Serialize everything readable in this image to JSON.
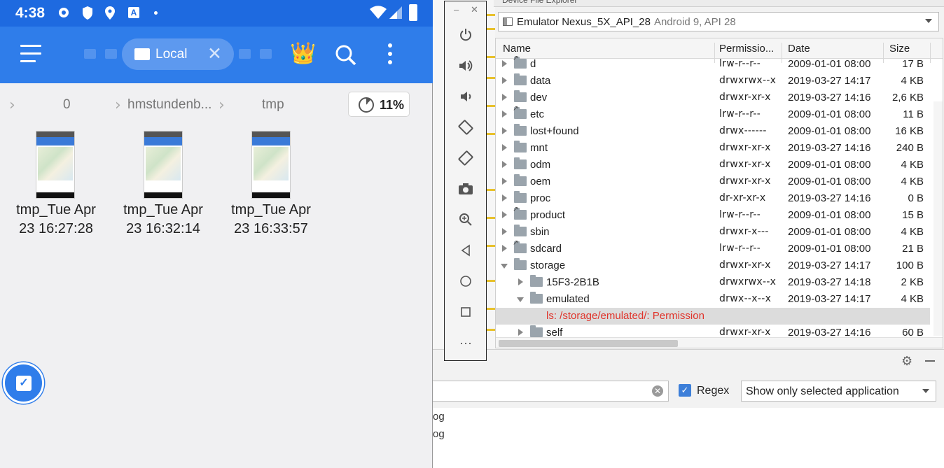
{
  "phone": {
    "status_time": "4:38",
    "appbar": {
      "local_tab_label": "Local"
    },
    "breadcrumbs": [
      "0",
      "hmstundenb...",
      "tmp"
    ],
    "storage_percent": "11%",
    "files": [
      {
        "line1": "tmp_Tue Apr",
        "line2": "23 16:27:28"
      },
      {
        "line1": "tmp_Tue Apr",
        "line2": "23 16:32:14"
      },
      {
        "line1": "tmp_Tue Apr",
        "line2": "23 16:33:57"
      }
    ]
  },
  "device_explorer": {
    "device_name": "Emulator Nexus_5X_API_28",
    "device_detail": "Android 9, API 28",
    "columns": {
      "name": "Name",
      "permissions": "Permissio...",
      "date": "Date",
      "size": "Size"
    },
    "rows": [
      {
        "name": "d",
        "perm": "lrw-r--r--",
        "date": "2009-01-01 08:00",
        "size": "17 B",
        "link": true
      },
      {
        "name": "data",
        "perm": "drwxrwx--x",
        "date": "2019-03-27 14:17",
        "size": "4 KB"
      },
      {
        "name": "dev",
        "perm": "drwxr-xr-x",
        "date": "2019-03-27 14:16",
        "size": "2,6 KB"
      },
      {
        "name": "etc",
        "perm": "lrw-r--r--",
        "date": "2009-01-01 08:00",
        "size": "11 B",
        "link": true
      },
      {
        "name": "lost+found",
        "perm": "drwx------",
        "date": "2009-01-01 08:00",
        "size": "16 KB"
      },
      {
        "name": "mnt",
        "perm": "drwxr-xr-x",
        "date": "2019-03-27 14:16",
        "size": "240 B"
      },
      {
        "name": "odm",
        "perm": "drwxr-xr-x",
        "date": "2009-01-01 08:00",
        "size": "4 KB"
      },
      {
        "name": "oem",
        "perm": "drwxr-xr-x",
        "date": "2009-01-01 08:00",
        "size": "4 KB"
      },
      {
        "name": "proc",
        "perm": "dr-xr-xr-x",
        "date": "2019-03-27 14:16",
        "size": "0 B"
      },
      {
        "name": "product",
        "perm": "lrw-r--r--",
        "date": "2009-01-01 08:00",
        "size": "15 B",
        "link": true
      },
      {
        "name": "sbin",
        "perm": "drwxr-x---",
        "date": "2009-01-01 08:00",
        "size": "4 KB"
      },
      {
        "name": "sdcard",
        "perm": "lrw-r--r--",
        "date": "2009-01-01 08:00",
        "size": "21 B",
        "link": true
      },
      {
        "name": "storage",
        "perm": "drwxr-xr-x",
        "date": "2019-03-27 14:17",
        "size": "100 B",
        "expanded": true
      },
      {
        "name": "15F3-2B1B",
        "perm": "drwxrwx--x",
        "date": "2019-03-27 14:18",
        "size": "2 KB",
        "indent": 1
      },
      {
        "name": "emulated",
        "perm": "drwx--x--x",
        "date": "2019-03-27 14:17",
        "size": "4 KB",
        "indent": 1,
        "expanded": true
      },
      {
        "error": "ls: /storage/emulated/: Permission"
      },
      {
        "name": "self",
        "perm": "drwxr-xr-x",
        "date": "2019-03-27 14:16",
        "size": "60 B",
        "indent": 1
      }
    ]
  },
  "logcat": {
    "regex_label": "Regex",
    "app_filter": "Show only selected application",
    "lines": [
      "og",
      "og"
    ]
  },
  "colors": {
    "accent": "#2f7dea",
    "error": "#e0342b"
  }
}
